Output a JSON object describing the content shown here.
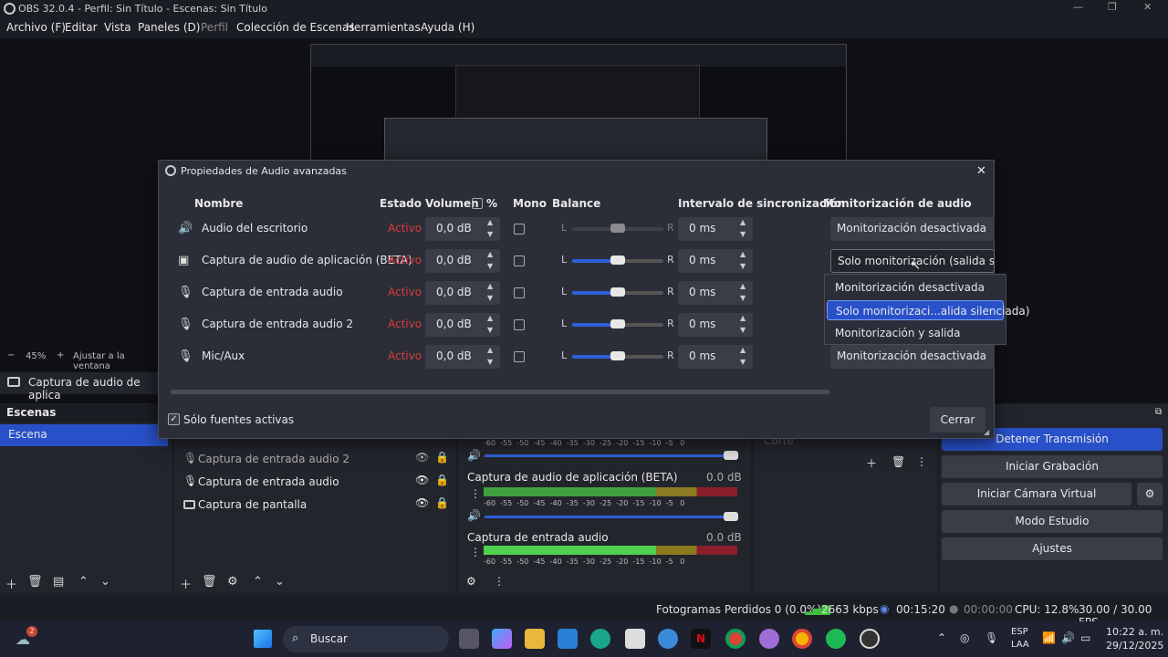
{
  "window": {
    "title": "OBS 32.0.4 - Perfil: Sin Título - Escenas: Sin Título"
  },
  "menu": [
    "Archivo (F)",
    "Editar",
    "Vista",
    "Paneles (D)",
    "Perfil",
    "Colección de Escenas",
    "Herramientas",
    "Ayuda (H)"
  ],
  "preview": {
    "zoom": "45%",
    "fit": "Ajustar a la ventana"
  },
  "source_bar": {
    "label": "Captura de audio de aplica"
  },
  "scenes": {
    "title": "Escenas",
    "items": [
      "Escena"
    ]
  },
  "sources": {
    "items": [
      "Captura de entrada audio 2",
      "Captura de entrada audio",
      "Captura de pantalla"
    ]
  },
  "mixer": {
    "ticks": [
      "-60",
      "-55",
      "-50",
      "-45",
      "-40",
      "-35",
      "-30",
      "-25",
      "-20",
      "-15",
      "-10",
      "-5",
      "0"
    ],
    "channels": [
      {
        "name": "Captura de audio de aplicación (BETA)",
        "db": "0.0 dB"
      },
      {
        "name": "Captura de entrada audio",
        "db": "0.0 dB"
      }
    ]
  },
  "transitions": {
    "value": "Corte"
  },
  "controls": [
    "Detener Transmisión",
    "Iniciar Grabación",
    "Iniciar Cámara Virtual",
    "Modo Estudio",
    "Ajustes"
  ],
  "dialog": {
    "title": "Propiedades de Audio avanzadas",
    "headers": {
      "name": "Nombre",
      "state": "Estado",
      "volume": "Volumen",
      "percent": "%",
      "mono": "Mono",
      "balance": "Balance",
      "sync": "Intervalo de sincronización",
      "monitor": "Monitorización de audio"
    },
    "rows": [
      {
        "name": "Audio del escritorio",
        "state": "Activo",
        "volume": "0,0 dB",
        "balance_l": "L",
        "balance_r": "R",
        "sync": "0 ms",
        "monitor": "Monitorización desactivada",
        "icon": "speaker-icon",
        "balance": 0.5,
        "disabled": true
      },
      {
        "name": "Captura de audio de aplicación (BETA)",
        "state": "Activo",
        "volume": "0,0 dB",
        "balance_l": "L",
        "balance_r": "R",
        "sync": "0 ms",
        "monitor": "Solo monitorización (salida silenciada)",
        "icon": "app-audio-icon",
        "balance": 0.5,
        "disabled": false
      },
      {
        "name": "Captura de entrada audio",
        "state": "Activo",
        "volume": "0,0 dB",
        "balance_l": "L",
        "balance_r": "R",
        "sync": "0 ms",
        "monitor": "",
        "icon": "microphone-icon",
        "balance": 0.5,
        "disabled": false
      },
      {
        "name": "Captura de entrada audio 2",
        "state": "Activo",
        "volume": "0,0 dB",
        "balance_l": "L",
        "balance_r": "R",
        "sync": "0 ms",
        "monitor": "",
        "icon": "microphone-icon",
        "balance": 0.5,
        "disabled": false
      },
      {
        "name": "Mic/Aux",
        "state": "Activo",
        "volume": "0,0 dB",
        "balance_l": "L",
        "balance_r": "R",
        "sync": "0 ms",
        "monitor": "Monitorización desactivada",
        "icon": "microphone-icon",
        "balance": 0.5,
        "disabled": false
      }
    ],
    "dropdown_options": [
      "Monitorización desactivada",
      "Solo monitorizaci...alida silenciada)",
      "Monitorización y salida"
    ],
    "active_only_label": "Sólo fuentes activas",
    "close_label": "Cerrar"
  },
  "status": {
    "dropped": "Fotogramas Perdidos 0 (0.0%)",
    "kbps": "2663 kbps",
    "stream_time": "00:15:20",
    "rec_time": "00:00:00",
    "cpu": "CPU: 12.8%",
    "fps": "30.00 / 30.00 FPS"
  },
  "taskbar": {
    "search": "Buscar",
    "lang1": "ESP",
    "lang2": "LAA",
    "time": "10:22 a. m.",
    "date": "29/12/2025",
    "badge": "2"
  }
}
